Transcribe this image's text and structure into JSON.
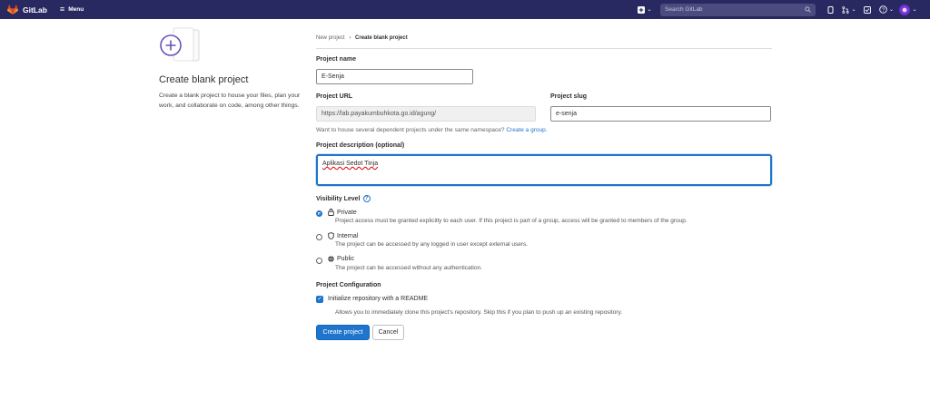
{
  "header": {
    "app_name": "GitLab",
    "menu_label": "Menu",
    "search_placeholder": "Search GitLab",
    "icons": [
      "plus-square-icon",
      "chevron-down-icon",
      "search-icon",
      "issues-icon",
      "merge-request-icon",
      "todo-icon",
      "help-icon",
      "avatar"
    ]
  },
  "sidebar": {
    "title": "Create blank project",
    "description": "Create a blank project to house your files, plan your work, and collaborate on code, among other things."
  },
  "breadcrumb": {
    "parent": "New project",
    "separator": "›",
    "current": "Create blank project"
  },
  "form": {
    "project_name_label": "Project name",
    "project_name_value": "E-Senja",
    "project_url_label": "Project URL",
    "project_url_value": "https://lab.payakumbuhkota.go.id/agung/",
    "project_slug_label": "Project slug",
    "project_slug_value": "e-senja",
    "namespace_help": "Want to house several dependent projects under the same namespace?",
    "namespace_link": "Create a group.",
    "description_label": "Project description (optional)",
    "description_value": "Aplikasi Sedot Tinja",
    "visibility_label": "Visibility Level",
    "visibility_options": [
      {
        "title": "Private",
        "icon": "lock-icon",
        "desc": "Project access must be granted explicitly to each user. If this project is part of a group, access will be granted to members of the group.",
        "selected": true
      },
      {
        "title": "Internal",
        "icon": "shield-icon",
        "desc": "The project can be accessed by any logged in user except external users.",
        "selected": false
      },
      {
        "title": "Public",
        "icon": "globe-icon",
        "desc": "The project can be accessed without any authentication.",
        "selected": false
      }
    ],
    "config_label": "Project Configuration",
    "readme_label": "Initialize repository with a README",
    "readme_checked": true,
    "readme_help": "Allows you to immediately clone this project's repository. Skip this if you plan to push up an existing repository.",
    "create_button": "Create project",
    "cancel_button": "Cancel"
  },
  "colors": {
    "topbar": "#292961",
    "accent": "#1f75cb",
    "logo_orange": "#fc6d26"
  }
}
